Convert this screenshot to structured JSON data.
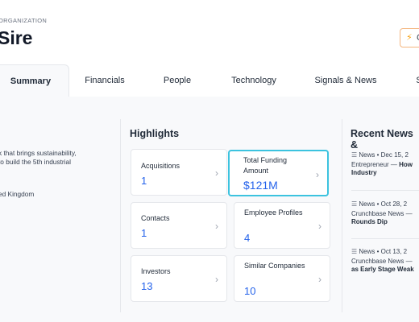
{
  "header": {
    "kicker": "ORGANIZATION",
    "org_name": "Sire",
    "action_label": "C"
  },
  "tabs": [
    "Summary",
    "Financials",
    "People",
    "Technology",
    "Signals & News",
    "S"
  ],
  "about": {
    "description_lines": [
      "k that brings sustainability,",
      "to build the 5th industrial"
    ],
    "location": "ed Kingdom"
  },
  "highlights": {
    "title": "Highlights",
    "cards": [
      {
        "label": "Acquisitions",
        "value": "1"
      },
      {
        "label": "Total Funding Amount",
        "value": "$121M"
      },
      {
        "label": "Contacts",
        "value": "1"
      },
      {
        "label": "Employee Profiles",
        "value": "4"
      },
      {
        "label": "Investors",
        "value": "13"
      },
      {
        "label": "Similar Companies",
        "value": "10"
      }
    ]
  },
  "news": {
    "title": "Recent News &",
    "items": [
      {
        "meta": "News • Dec 15, 2",
        "source": "Entrepreneur — ",
        "headline": "How",
        "headline2": "Industry"
      },
      {
        "meta": "News • Oct 28, 2",
        "source": "Crunchbase News — ",
        "headline": "",
        "headline2": "Rounds Dip"
      },
      {
        "meta": "News • Oct 13, 2",
        "source": "Crunchbase News — ",
        "headline": "",
        "headline2": "as Early Stage Weak"
      }
    ]
  },
  "colors": {
    "accent_blue": "#2563eb",
    "selected_border": "#3cc3df",
    "action_border": "#f4b67f"
  }
}
